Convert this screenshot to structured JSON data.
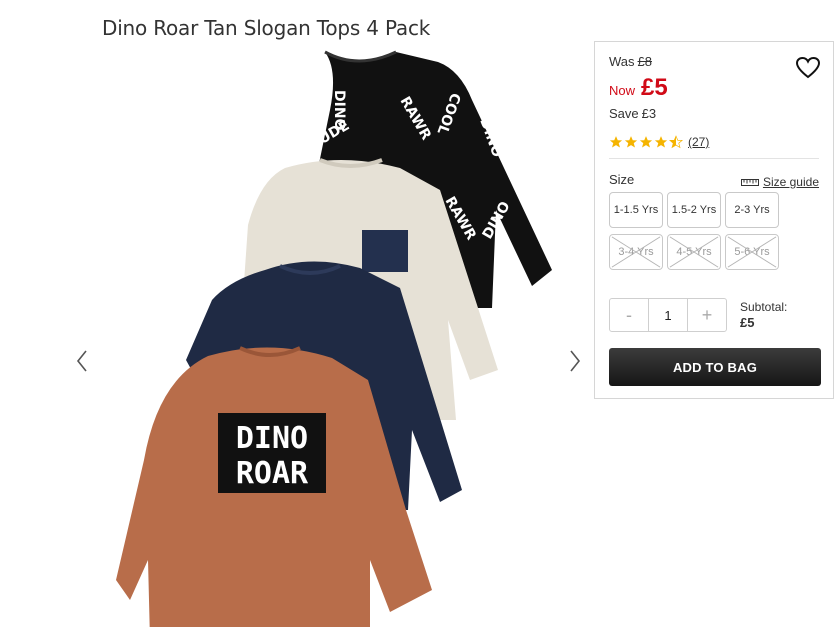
{
  "product": {
    "title": "Dino Roar Tan Slogan Tops 4 Pack"
  },
  "gallery": {
    "image_alt": "Four long sleeve tops: black slogan print, cream with navy pocket, navy marl, tan with DINO ROAR print",
    "tan_print_line1": "DINO",
    "tan_print_line2": "ROAR",
    "black_print_words": [
      "DINO",
      "RAWR",
      "COOL",
      "DUDE"
    ]
  },
  "pricing": {
    "was_label": "Was",
    "was_price": "£8",
    "now_label": "Now",
    "now_price": "£5",
    "save_label": "Save",
    "save_amount": "£3"
  },
  "rating": {
    "stars": 4.5,
    "count": "(27)"
  },
  "size": {
    "label": "Size",
    "guide_label": "Size guide",
    "options": [
      {
        "label": "1-1.5 Yrs",
        "available": true
      },
      {
        "label": "1.5-2 Yrs",
        "available": true
      },
      {
        "label": "2-3 Yrs",
        "available": true
      },
      {
        "label": "3-4 Yrs",
        "available": false
      },
      {
        "label": "4-5 Yrs",
        "available": false
      },
      {
        "label": "5-6 Yrs",
        "available": false
      }
    ]
  },
  "quantity": {
    "minus": "-",
    "value": "1",
    "plus": "+"
  },
  "subtotal": {
    "label": "Subtotal:",
    "amount": "£5"
  },
  "cart": {
    "add_label": "ADD TO BAG"
  },
  "colors": {
    "price_red": "#d10a17",
    "star_gold": "#f5b400",
    "button_dark": "#1e1e1e",
    "tan": "#b86d4a",
    "navy": "#1f2a44",
    "cream": "#e6e1d6",
    "black_top": "#111111"
  }
}
